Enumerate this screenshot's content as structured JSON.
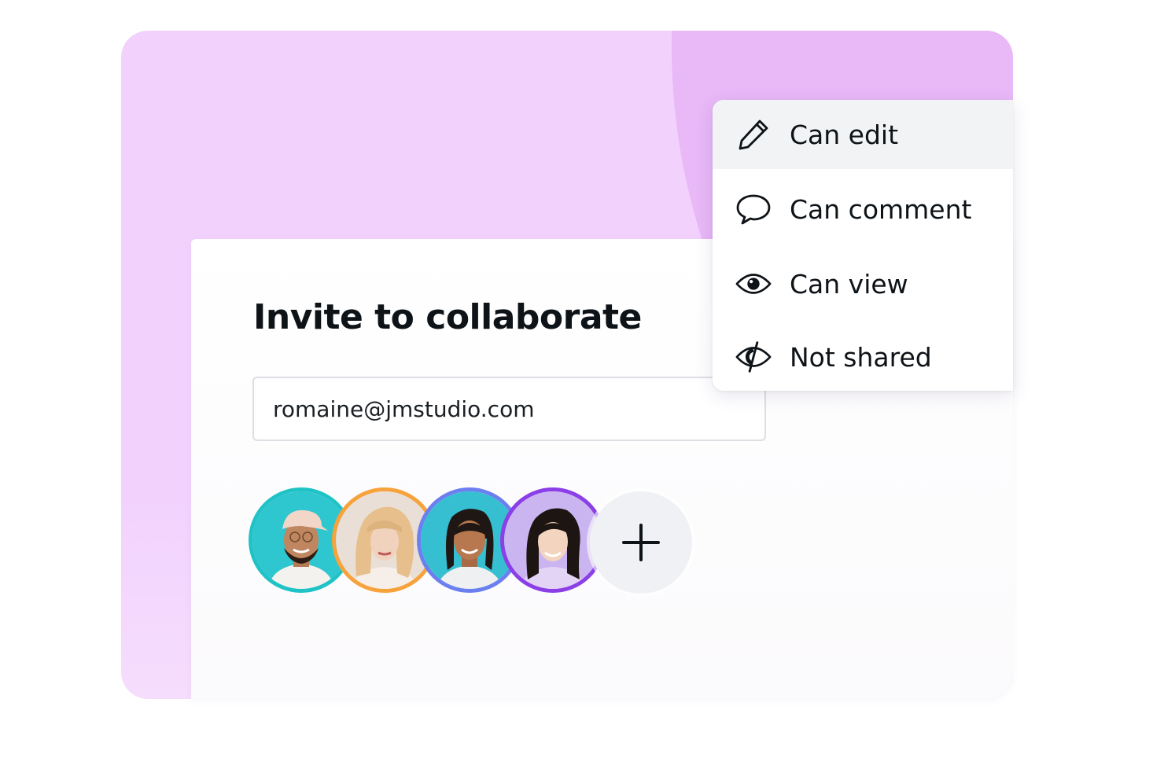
{
  "invite": {
    "title": "Invite to collaborate",
    "email_value": "romaine@jmstudio.com",
    "add_icon": "plus-icon"
  },
  "permission_menu": {
    "items": [
      {
        "label": "Can edit",
        "icon": "pencil-icon",
        "selected": true
      },
      {
        "label": "Can comment",
        "icon": "speech-bubble-icon",
        "selected": false
      },
      {
        "label": "Can view",
        "icon": "eye-icon",
        "selected": false
      },
      {
        "label": "Not shared",
        "icon": "eye-slash-icon",
        "selected": false
      }
    ]
  },
  "collaborators": [
    {
      "ring_color": "#1fc3c6"
    },
    {
      "ring_color": "#f7a23a"
    },
    {
      "ring_color": "#6c7ff0"
    },
    {
      "ring_color": "#8b3fe6"
    }
  ],
  "colors": {
    "background_light": "#f2d2fd",
    "background_accent": "#e8b8f7",
    "text": "#0e1318"
  }
}
